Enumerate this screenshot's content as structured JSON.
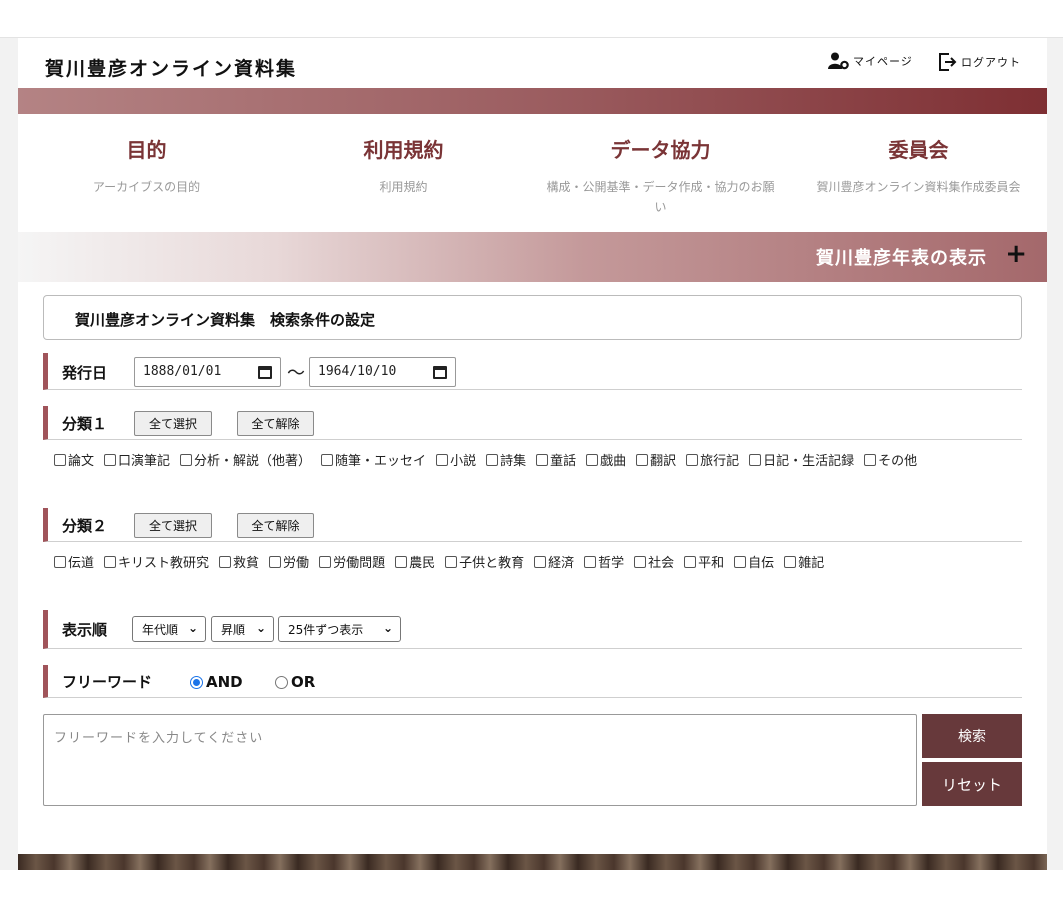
{
  "header": {
    "site_title": "賀川豊彦オンライン資料集",
    "mypage_label": "マイページ",
    "logout_label": "ログアウト"
  },
  "nav": [
    {
      "title": "目的",
      "subtitle": "アーカイブスの目的"
    },
    {
      "title": "利用規約",
      "subtitle": "利用規約"
    },
    {
      "title": "データ協力",
      "subtitle": "構成・公開基準・データ作成・協力のお願い"
    },
    {
      "title": "委員会",
      "subtitle": "賀川豊彦オンライン資料集作成委員会"
    }
  ],
  "timeline": {
    "label": "賀川豊彦年表の表示",
    "toggle": "+"
  },
  "search": {
    "box_title": "賀川豊彦オンライン資料集　検索条件の設定",
    "date": {
      "label": "発行日",
      "from": "1888/01/01",
      "to": "1964/10/10",
      "separator": "〜"
    },
    "category1": {
      "label": "分類１",
      "select_all": "全て選択",
      "clear_all": "全て解除",
      "options": [
        "論文",
        "口演筆記",
        "分析・解説（他著）",
        "随筆・エッセイ",
        "小説",
        "詩集",
        "童話",
        "戯曲",
        "翻訳",
        "旅行記",
        "日記・生活記録",
        "その他"
      ]
    },
    "category2": {
      "label": "分類２",
      "select_all": "全て選択",
      "clear_all": "全て解除",
      "options": [
        "伝道",
        "キリスト教研究",
        "救貧",
        "労働",
        "労働問題",
        "農民",
        "子供と教育",
        "経済",
        "哲学",
        "社会",
        "平和",
        "自伝",
        "雑記"
      ]
    },
    "order": {
      "label": "表示順",
      "sort": "年代順",
      "direction": "昇順",
      "per_page": "25件ずつ表示"
    },
    "freeword": {
      "label": "フリーワード",
      "and_label": "AND",
      "or_label": "OR",
      "selected": "AND",
      "placeholder": "フリーワードを入力してください",
      "search_button": "検索",
      "reset_button": "リセット"
    }
  },
  "colors": {
    "accent": "#7a3436",
    "button_dark": "#67393b",
    "section_bar": "#a0545a"
  }
}
